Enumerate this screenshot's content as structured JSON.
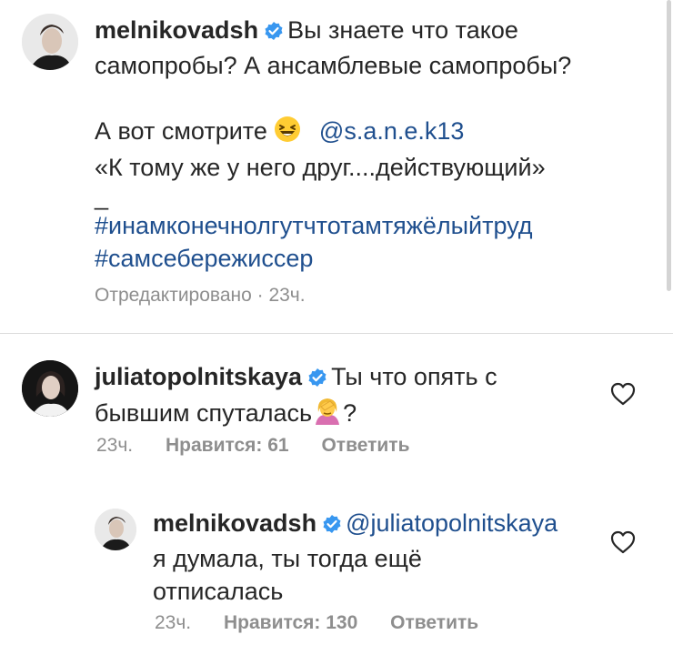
{
  "post": {
    "username": "melnikovadsh",
    "caption_line1": "Вы знаете что такое",
    "caption_line2": "самопробы? А ансамблевые самопробы?",
    "caption_line3_text": "А вот смотрите",
    "caption_line3_emoji": "laughing-emoji",
    "caption_mention": "@s.a.n.e.k13",
    "caption_quote": "«К тому же у него друг....действующий»",
    "caption_dash": "_",
    "hashtag1": "#инамконечнолгутчтотамтяжёлыйтруд",
    "hashtag2": "#самсебережиссер",
    "meta": "Отредактировано · 23ч."
  },
  "comments": [
    {
      "username": "juliatopolnitskaya",
      "text_line1": "Ты что опять с",
      "text_line2": "бывшим спуталась",
      "text_emoji": "facepalm-emoji",
      "text_end": "?",
      "time": "23ч.",
      "likes": "Нравится: 61",
      "reply": "Ответить"
    },
    {
      "username": "melnikovadsh",
      "mention": "@juliatopolnitskaya",
      "text_line1": "я думала, ты тогда ещё",
      "text_line2": "отписалась",
      "time": "23ч.",
      "likes": "Нравится: 130",
      "reply": "Ответить"
    }
  ],
  "colors": {
    "text": "#262626",
    "link": "#1f4f8e",
    "muted": "#8e8e8e",
    "verified": "#3897f0",
    "divider": "#dbdbdb"
  },
  "icons": [
    "verified-badge-icon",
    "heart-icon",
    "laughing-emoji",
    "facepalm-emoji"
  ]
}
